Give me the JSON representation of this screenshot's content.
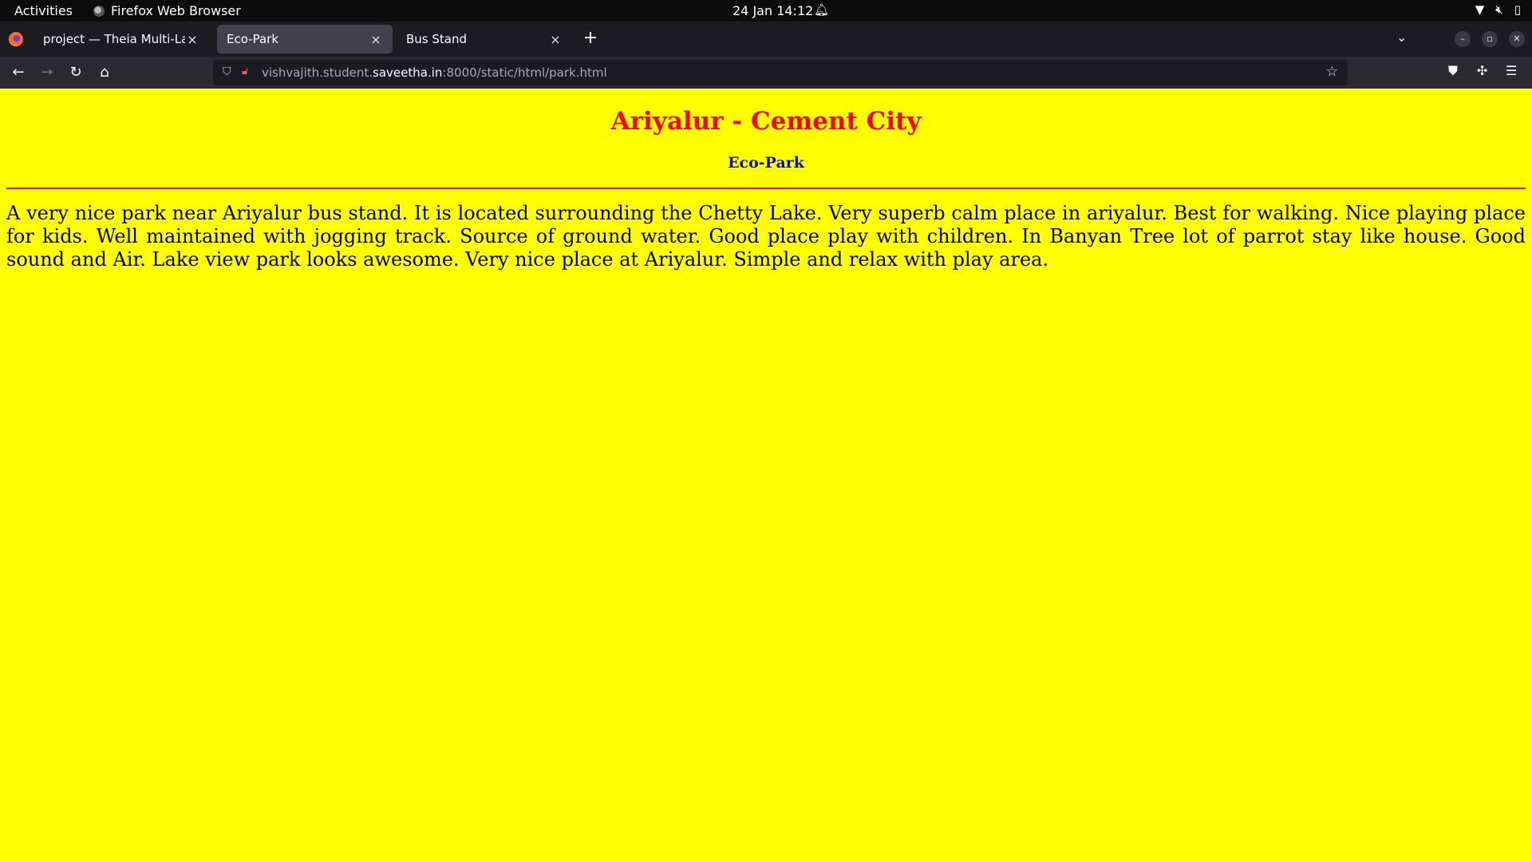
{
  "topbar": {
    "activities": "Activities",
    "app_name": "Firefox Web Browser",
    "clock": "24 Jan  14:12",
    "icons": [
      "bell-icon",
      "wifi-icon",
      "volume-muted-icon",
      "battery-icon"
    ]
  },
  "tabs": [
    {
      "title": "project — Theia Multi-Langu",
      "close": "×",
      "active": false
    },
    {
      "title": "Eco-Park",
      "close": "×",
      "active": true
    },
    {
      "title": "Bus Stand",
      "close": "×",
      "active": false
    }
  ],
  "tabbar": {
    "new_tab": "+",
    "list_all_tabs": "⌄"
  },
  "window_controls": {
    "minimize": "–",
    "restore": "▫",
    "close": "✕"
  },
  "navbar": {
    "back": "←",
    "forward": "→",
    "reload": "↻",
    "home": "⌂",
    "url_prefix": "vishvajith.student.",
    "url_domain": "saveetha.in",
    "url_suffix": ":8000/static/html/park.html",
    "bookmark": "☆"
  },
  "page": {
    "title": "Ariyalur - Cement City",
    "subtitle": "Eco-Park",
    "paragraph": "A very nice park near Ariyalur bus stand. It is located surrounding the Chetty Lake. Very superb calm place in ariyalur. Best for walking. Nice playing place for kids. Well maintained with jogging track. Source of ground water. Good place play with children. In Banyan Tree lot of parrot stay like house. Good sound and Air. Lake view park looks awesome. Very nice place at Ariyalur. Simple and relax with play area."
  },
  "colors": {
    "page_background": "#ffff00",
    "title": "#ff0000",
    "subtitle": "#1010b0",
    "rule": "#ff0000"
  }
}
